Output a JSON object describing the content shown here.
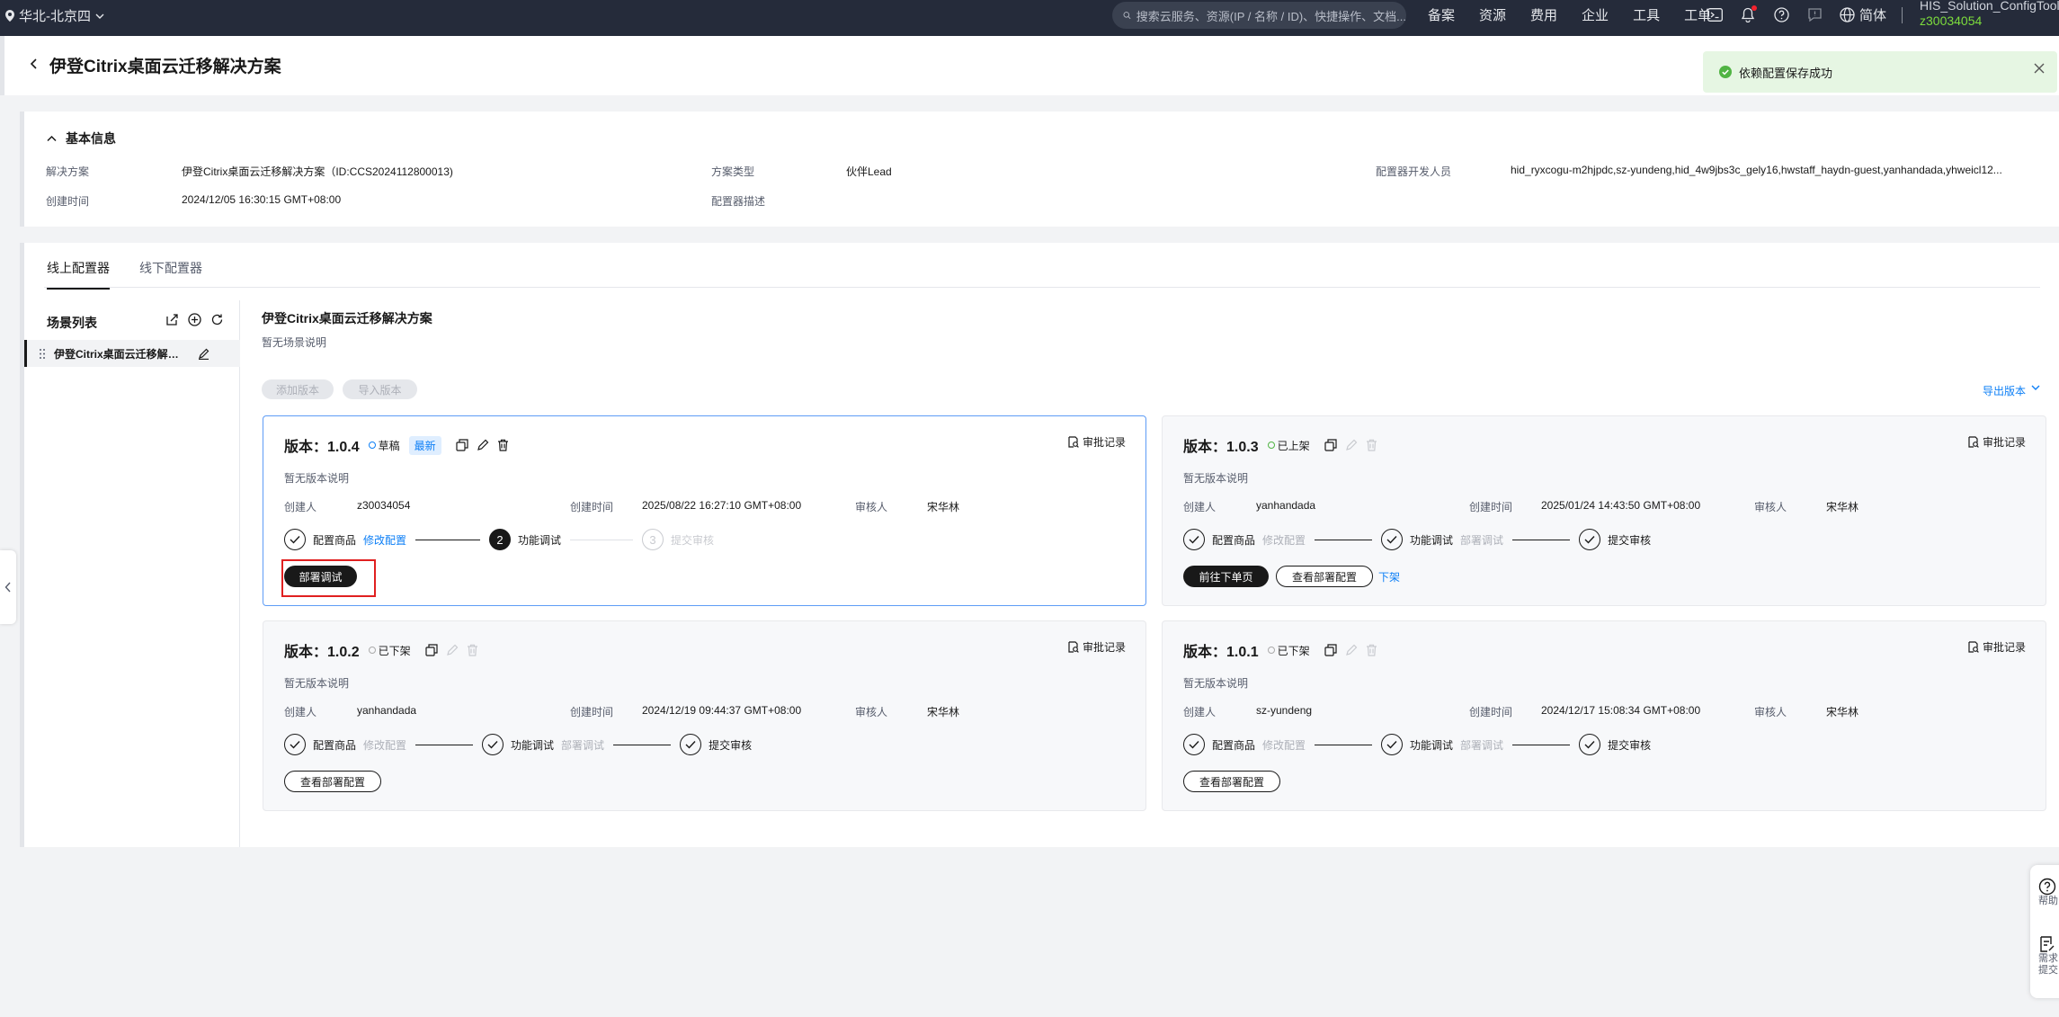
{
  "topbar": {
    "region": "华北-北京四",
    "search_placeholder": "搜索云服务、资源(IP / 名称 / ID)、快捷操作、文档...",
    "nav": [
      "备案",
      "资源",
      "费用",
      "企业",
      "工具",
      "工单"
    ],
    "lang": "简体",
    "app_name": "HIS_Solution_ConfigTool",
    "user_id": "z30034054"
  },
  "header": {
    "title": "伊登Citrix桌面云迁移解决方案"
  },
  "toast": {
    "message": "依赖配置保存成功"
  },
  "basic_info": {
    "section_title": "基本信息",
    "fields": [
      {
        "key": "解决方案",
        "value": "伊登Citrix桌面云迁移解决方案（ID:CCS2024112800013)"
      },
      {
        "key": "方案类型",
        "value": "伙伴Lead"
      },
      {
        "key": "配置器开发人员",
        "value": "hid_ryxcogu-m2hjpdc,sz-yundeng,hid_4w9jbs3c_gely16,hwstaff_haydn-guest,yanhandada,yhweicl12..."
      },
      {
        "key": "创建时间",
        "value": "2024/12/05 16:30:15 GMT+08:00"
      },
      {
        "key": "配置器描述",
        "value": ""
      }
    ]
  },
  "tabs": [
    "线上配置器",
    "线下配置器"
  ],
  "scene_list": {
    "title": "场景列表",
    "items": [
      "伊登Citrix桌面云迁移解决方案"
    ]
  },
  "scene": {
    "title": "伊登Citrix桌面云迁移解决方案",
    "desc": "暂无场景说明",
    "add_version": "添加版本",
    "import_version": "导入版本",
    "export_version": "导出版本"
  },
  "labels": {
    "creator": "创建人",
    "created_at": "创建时间",
    "reviewer": "审核人",
    "audit_record": "审批记录",
    "no_desc": "暂无版本说明",
    "step1": "配置商品",
    "step1_link": "修改配置",
    "step2": "功能调试",
    "step2_link": "部署调试",
    "step3": "提交审核",
    "step3_num": "3",
    "step2_num": "2",
    "newest": "最新"
  },
  "versions": [
    {
      "title": "版本：1.0.4",
      "status": "草稿",
      "creator": "z30034054",
      "created_at": "2025/08/22 16:27:10 GMT+08:00",
      "reviewer": "宋华林",
      "buttons": [
        "部署调试"
      ]
    },
    {
      "title": "版本：1.0.3",
      "status": "已上架",
      "creator": "yanhandada",
      "created_at": "2025/01/24 14:43:50 GMT+08:00",
      "reviewer": "宋华林",
      "buttons": [
        "前往下单页",
        "查看部署配置"
      ],
      "link": "下架"
    },
    {
      "title": "版本：1.0.2",
      "status": "已下架",
      "creator": "yanhandada",
      "created_at": "2024/12/19 09:44:37 GMT+08:00",
      "reviewer": "宋华林",
      "buttons": [
        "查看部署配置"
      ]
    },
    {
      "title": "版本：1.0.1",
      "status": "已下架",
      "creator": "sz-yundeng",
      "created_at": "2024/12/17 15:08:34 GMT+08:00",
      "reviewer": "宋华林",
      "buttons": [
        "查看部署配置"
      ]
    }
  ],
  "float_panel": {
    "help": "帮助",
    "request": "需求提交"
  },
  "colors": {
    "topbar": "#252b3a",
    "accent": "#0d7ff6",
    "success": "#50b443",
    "highlight": "#e02020"
  }
}
